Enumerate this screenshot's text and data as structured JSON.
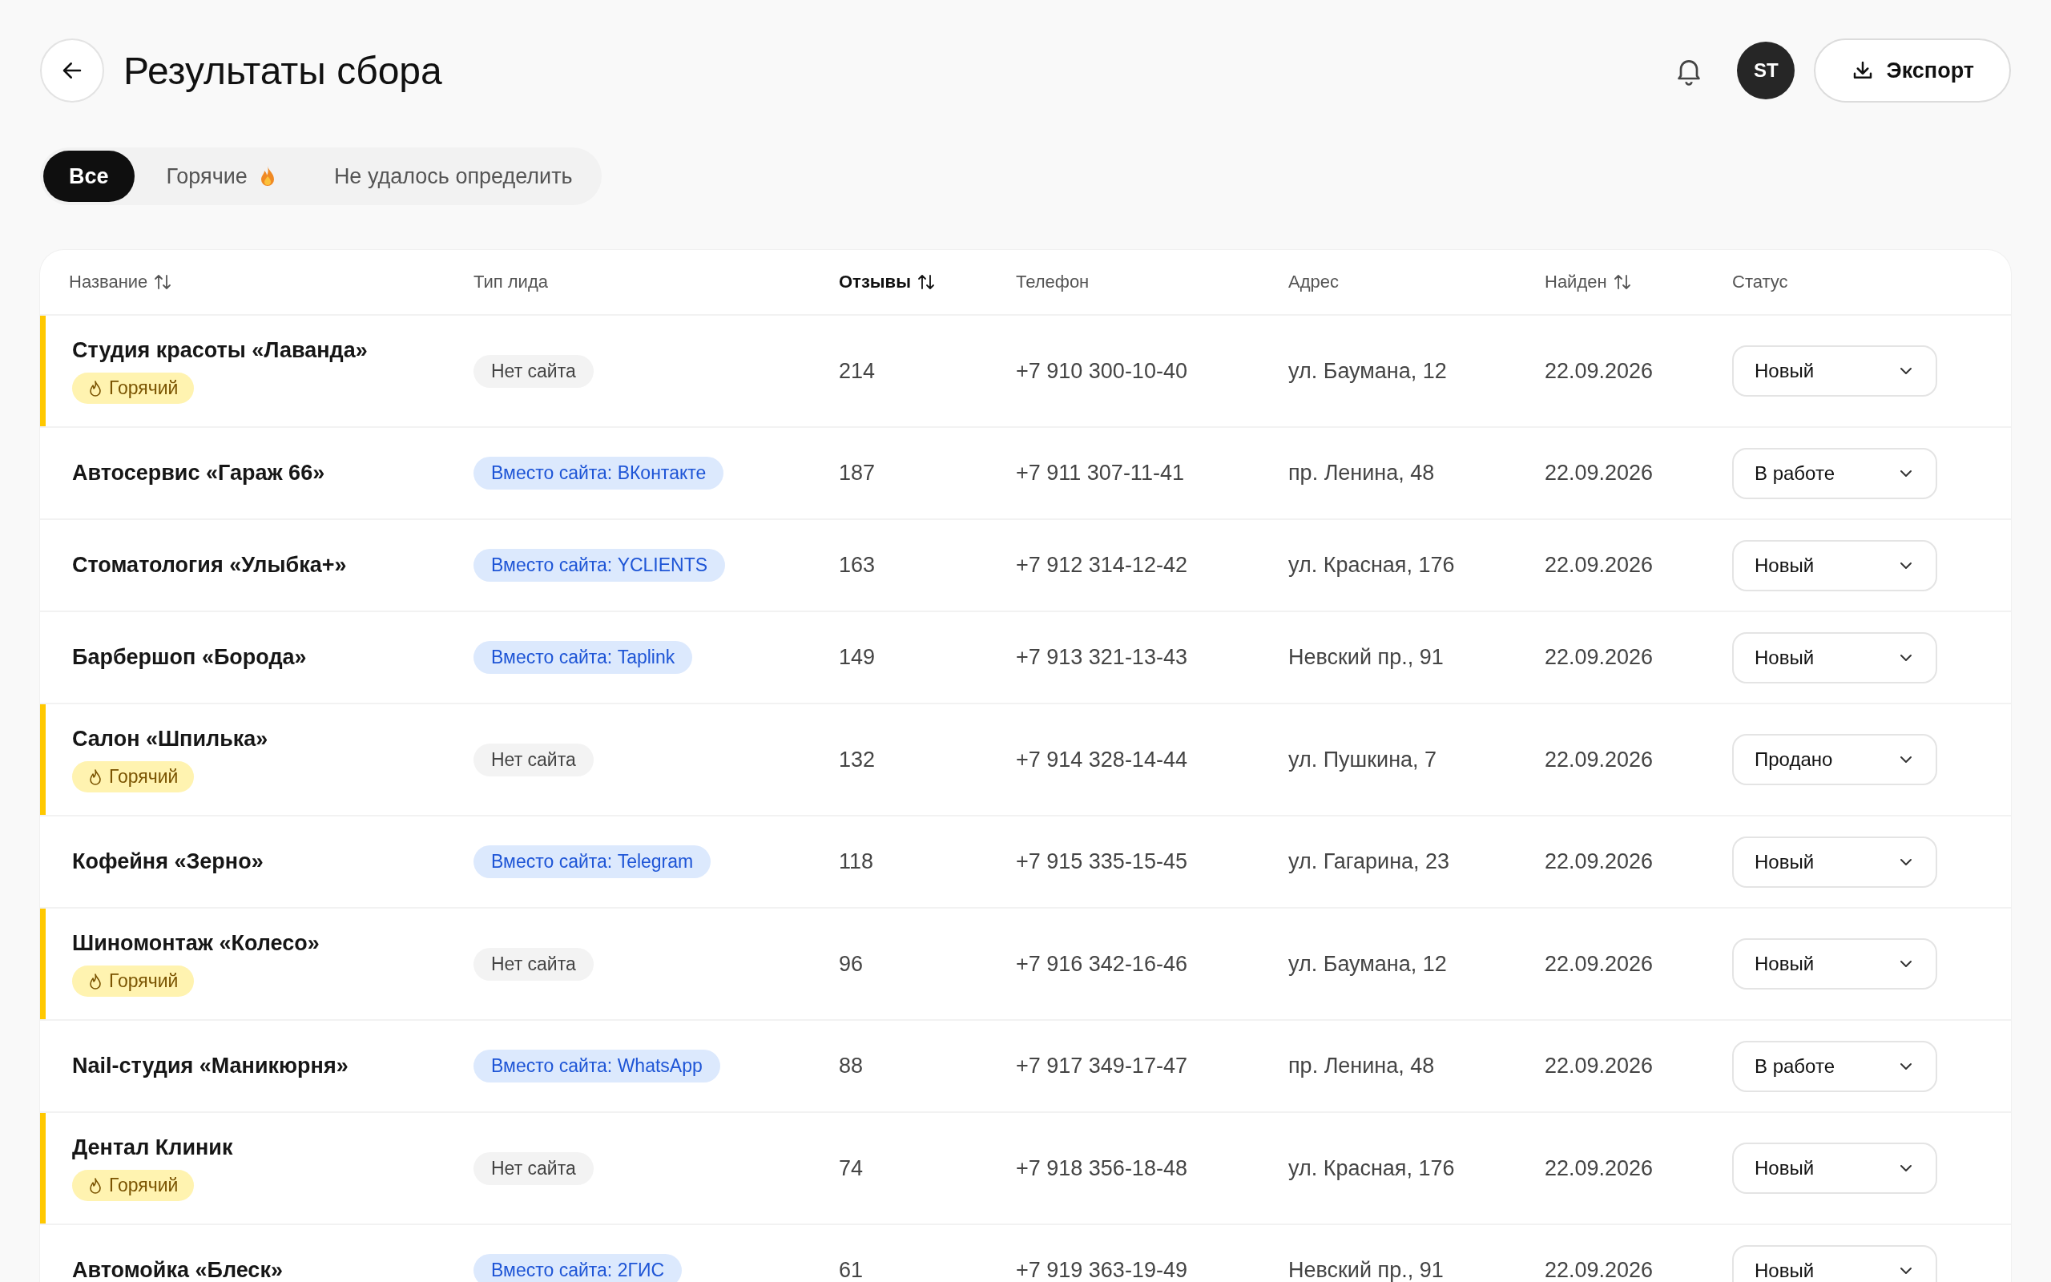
{
  "header": {
    "title": "Результаты сбора",
    "avatar": "ST",
    "export_button": "Экспорт"
  },
  "tabs": [
    {
      "label": "Все",
      "selected": true,
      "kind": "plain"
    },
    {
      "label": "Горячие",
      "selected": false,
      "kind": "fire"
    },
    {
      "label": "Не удалось определить",
      "selected": false,
      "kind": "plain"
    }
  ],
  "table": {
    "columns": [
      {
        "label": "Название",
        "sortable": true,
        "sorted": false
      },
      {
        "label": "Тип лида",
        "sortable": false,
        "sorted": false
      },
      {
        "label": "Отзывы",
        "sortable": true,
        "sorted": true
      },
      {
        "label": "Телефон",
        "sortable": false,
        "sorted": false
      },
      {
        "label": "Адрес",
        "sortable": false,
        "sorted": false
      },
      {
        "label": "Найден",
        "sortable": true,
        "sorted": false
      },
      {
        "label": "Статус",
        "sortable": false,
        "sorted": false
      }
    ],
    "rows": [
      {
        "name": "Студия красоты «Лаванда»",
        "hot": true,
        "hot_badge": "Горячий",
        "lead_type": {
          "kind": "none",
          "label": "Нет сайта"
        },
        "reviews": "214",
        "phone": "+7 910 300-10-40",
        "address": "ул. Баумана, 12",
        "found": "22.09.2026",
        "status": "Новый"
      },
      {
        "name": "Автосервис «Гараж 66»",
        "hot": false,
        "lead_type": {
          "kind": "alt",
          "label": "Вместо сайта: ВКонтакте"
        },
        "reviews": "187",
        "phone": "+7 911 307-11-41",
        "address": "пр. Ленина, 48",
        "found": "22.09.2026",
        "status": "В работе"
      },
      {
        "name": "Стоматология «Улыбка+»",
        "hot": false,
        "lead_type": {
          "kind": "alt",
          "label": "Вместо сайта: YCLIENTS"
        },
        "reviews": "163",
        "phone": "+7 912 314-12-42",
        "address": "ул. Красная, 176",
        "found": "22.09.2026",
        "status": "Новый"
      },
      {
        "name": "Барбершоп «Борода»",
        "hot": false,
        "lead_type": {
          "kind": "alt",
          "label": "Вместо сайта: Taplink"
        },
        "reviews": "149",
        "phone": "+7 913 321-13-43",
        "address": "Невский пр., 91",
        "found": "22.09.2026",
        "status": "Новый"
      },
      {
        "name": "Салон «Шпилька»",
        "hot": true,
        "hot_badge": "Горячий",
        "lead_type": {
          "kind": "none",
          "label": "Нет сайта"
        },
        "reviews": "132",
        "phone": "+7 914 328-14-44",
        "address": "ул. Пушкина, 7",
        "found": "22.09.2026",
        "status": "Продано"
      },
      {
        "name": "Кофейня «Зерно»",
        "hot": false,
        "lead_type": {
          "kind": "alt",
          "label": "Вместо сайта: Telegram"
        },
        "reviews": "118",
        "phone": "+7 915 335-15-45",
        "address": "ул. Гагарина, 23",
        "found": "22.09.2026",
        "status": "Новый"
      },
      {
        "name": "Шиномонтаж «Колесо»",
        "hot": true,
        "hot_badge": "Горячий",
        "lead_type": {
          "kind": "none",
          "label": "Нет сайта"
        },
        "reviews": "96",
        "phone": "+7 916 342-16-46",
        "address": "ул. Баумана, 12",
        "found": "22.09.2026",
        "status": "Новый"
      },
      {
        "name": "Nail-студия «Маникюрня»",
        "hot": false,
        "lead_type": {
          "kind": "alt",
          "label": "Вместо сайта: WhatsApp"
        },
        "reviews": "88",
        "phone": "+7 917 349-17-47",
        "address": "пр. Ленина, 48",
        "found": "22.09.2026",
        "status": "В работе"
      },
      {
        "name": "Дентал Клиник",
        "hot": true,
        "hot_badge": "Горячий",
        "lead_type": {
          "kind": "none",
          "label": "Нет сайта"
        },
        "reviews": "74",
        "phone": "+7 918 356-18-48",
        "address": "ул. Красная, 176",
        "found": "22.09.2026",
        "status": "Новый"
      },
      {
        "name": "Автомойка «Блеск»",
        "hot": false,
        "lead_type": {
          "kind": "alt",
          "label": "Вместо сайта: 2ГИС"
        },
        "reviews": "61",
        "phone": "+7 919 363-19-49",
        "address": "Невский пр., 91",
        "found": "22.09.2026",
        "status": "Новый"
      }
    ]
  }
}
